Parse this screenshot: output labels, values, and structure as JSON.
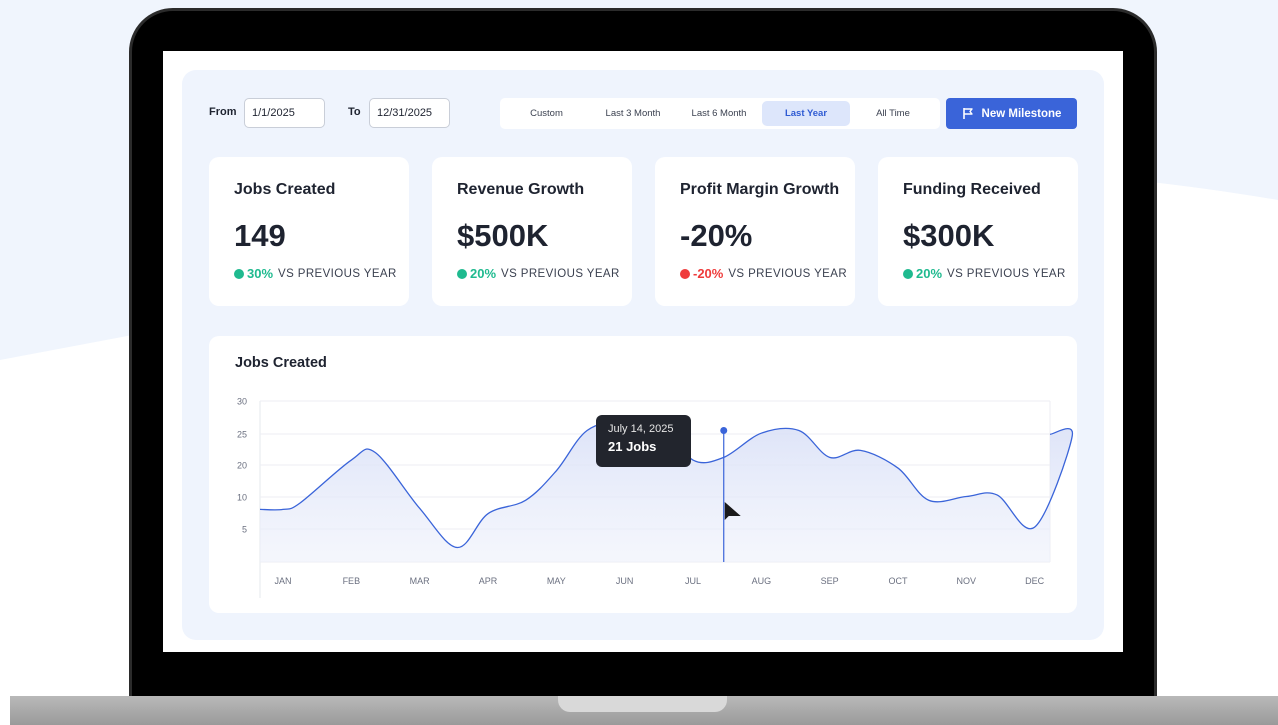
{
  "filters": {
    "from_label": "From",
    "from_value": "1/1/2025",
    "to_label": "To",
    "to_value": "12/31/2025",
    "ranges": [
      "Custom",
      "Last 3 Month",
      "Last 6 Month",
      "Last Year",
      "All Time"
    ],
    "active_range": "Last Year"
  },
  "actions": {
    "new_milestone_label": "New Milestone",
    "new_milestone_icon": "flag-icon"
  },
  "cards": [
    {
      "title": "Jobs Created",
      "value": "149",
      "delta": "30%",
      "trend": "up",
      "note": "VS PREVIOUS YEAR"
    },
    {
      "title": "Revenue Growth",
      "value": "$500K",
      "delta": "20%",
      "trend": "up",
      "note": "VS PREVIOUS YEAR"
    },
    {
      "title": "Profit Margin Growth",
      "value": "-20%",
      "delta": "-20%",
      "trend": "down",
      "note": "VS PREVIOUS YEAR"
    },
    {
      "title": "Funding Received",
      "value": "$300K",
      "delta": "20%",
      "trend": "up",
      "note": "VS PREVIOUS YEAR"
    }
  ],
  "colors": {
    "accent": "#3a64d9",
    "positive": "#1fba8f",
    "negative": "#ef3b3b",
    "panel": "#eff4fd"
  },
  "chart_data": {
    "type": "line",
    "title": "Jobs Created",
    "categories": [
      "JAN",
      "FEB",
      "MAR",
      "APR",
      "MAY",
      "JUN",
      "JUL",
      "AUG",
      "SEP",
      "OCT",
      "NOV",
      "DEC"
    ],
    "y_ticks": [
      5,
      10,
      20,
      25,
      30
    ],
    "ylim": [
      0,
      30
    ],
    "x": [
      0,
      0.25,
      1,
      1.35,
      2,
      2.55,
      3,
      3.55,
      4,
      4.45,
      5,
      5.55,
      6,
      6.45,
      7,
      7.55,
      8,
      8.45,
      9,
      9.45,
      10,
      10.45,
      11,
      11.55
    ],
    "values": [
      9.8,
      11,
      19,
      20.4,
      10,
      2.7,
      9,
      11.5,
      17,
      24.5,
      26.3,
      25.5,
      19,
      19.5,
      24,
      24.5,
      19.5,
      20.8,
      17.5,
      11.5,
      12.2,
      12.5,
      6.5,
      23.5
    ],
    "grid": true,
    "tooltip": {
      "date": "July 14, 2025",
      "value_label": "21 Jobs"
    },
    "marker": {
      "x": 6.45,
      "value": 24.5
    }
  }
}
